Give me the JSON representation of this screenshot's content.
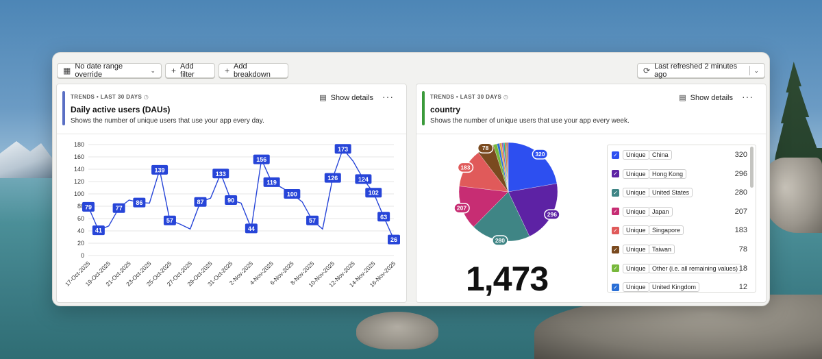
{
  "toolbar": {
    "date_label": "No date range override",
    "filter_label": "Add filter",
    "breakdown_label": "Add breakdown",
    "refresh_label": "Last refreshed 2 minutes ago"
  },
  "cards": [
    {
      "kicker": "TRENDS • LAST 30 DAYS",
      "title": "Daily active users (DAUs)",
      "description": "Shows the number of unique users that use your app every day.",
      "details_label": "Show details",
      "accent": "#5a6fc4"
    },
    {
      "kicker": "TRENDS • LAST 30 DAYS",
      "title": "country",
      "description": "Shows the number of unique users that use your app every week.",
      "details_label": "Show details",
      "accent": "#3a9a3a"
    }
  ],
  "chart_data": [
    {
      "type": "line",
      "x": [
        "17-Oct-2025",
        "18-Oct-2025",
        "19-Oct-2025",
        "20-Oct-2025",
        "21-Oct-2025",
        "22-Oct-2025",
        "23-Oct-2025",
        "24-Oct-2025",
        "25-Oct-2025",
        "26-Oct-2025",
        "27-Oct-2025",
        "28-Oct-2025",
        "29-Oct-2025",
        "30-Oct-2025",
        "31-Oct-2025",
        "1-Nov-2025",
        "2-Nov-2025",
        "3-Nov-2025",
        "4-Nov-2025",
        "5-Nov-2025",
        "6-Nov-2025",
        "7-Nov-2025",
        "8-Nov-2025",
        "9-Nov-2025",
        "10-Nov-2025",
        "11-Nov-2025",
        "12-Nov-2025",
        "13-Nov-2025",
        "14-Nov-2025",
        "15-Nov-2025",
        "16-Nov-2025"
      ],
      "tick_labels": [
        "17-Oct-2025",
        "19-Oct-2025",
        "21-Oct-2025",
        "23-Oct-2025",
        "25-Oct-2025",
        "27-Oct-2025",
        "29-Oct-2025",
        "31-Oct-2025",
        "2-Nov-2025",
        "4-Nov-2025",
        "6-Nov-2025",
        "8-Nov-2025",
        "10-Nov-2025",
        "12-Nov-2025",
        "14-Nov-2025",
        "16-Nov-2025"
      ],
      "series": [
        {
          "values": [
            79,
            41,
            48,
            77,
            90,
            86,
            85,
            139,
            57,
            51,
            43,
            87,
            93,
            133,
            90,
            85,
            44,
            156,
            119,
            110,
            100,
            87,
            57,
            43,
            126,
            173,
            153,
            124,
            102,
            63,
            26
          ],
          "labeled": [
            0,
            1,
            3,
            5,
            7,
            8,
            11,
            13,
            14,
            16,
            17,
            18,
            20,
            22,
            24,
            25,
            27,
            28,
            29,
            30
          ],
          "color": "#2745d8"
        }
      ],
      "ylim": [
        0,
        180
      ],
      "yticks": [
        0,
        20,
        40,
        60,
        80,
        100,
        120,
        140,
        160,
        180
      ],
      "grid": true
    },
    {
      "type": "pie",
      "total_label": "1,473",
      "slices": [
        {
          "label": "China",
          "value": 320,
          "color": "#2d4ff0",
          "show": true
        },
        {
          "label": "Hong Kong",
          "value": 296,
          "color": "#5d22a4",
          "show": true
        },
        {
          "label": "United States",
          "value": 280,
          "color": "#3f8585",
          "show": true
        },
        {
          "label": "Japan",
          "value": 207,
          "color": "#c72d73",
          "show": true
        },
        {
          "label": "Singapore",
          "value": 183,
          "color": "#e05a5a",
          "show": true
        },
        {
          "label": "Taiwan",
          "value": 78,
          "color": "#7a4a1f",
          "show": true
        },
        {
          "label": "Other (i.e. all remaining values)",
          "value": 18,
          "color": "#78b83c",
          "show": false
        },
        {
          "label": "United Kingdom",
          "value": 12,
          "color": "#2a6fd6",
          "show": false
        },
        {
          "label": "",
          "value": 10,
          "color": "#e6a23c",
          "show": false
        },
        {
          "label": "",
          "value": 8,
          "color": "#9b59b6",
          "show": false
        },
        {
          "label": "",
          "value": 7,
          "color": "#1abc9c",
          "show": false
        },
        {
          "label": "",
          "value": 6,
          "color": "#d35400",
          "show": false
        },
        {
          "label": "",
          "value": 5,
          "color": "#7f8c8d",
          "show": false
        },
        {
          "label": "",
          "value": 5,
          "color": "#c0392b",
          "show": false
        }
      ]
    }
  ],
  "legend": {
    "unique_label": "Unique",
    "rows": [
      {
        "name": "China",
        "value": "320",
        "color": "#2d4ff0"
      },
      {
        "name": "Hong Kong",
        "value": "296",
        "color": "#5d22a4"
      },
      {
        "name": "United States",
        "value": "280",
        "color": "#3f8585"
      },
      {
        "name": "Japan",
        "value": "207",
        "color": "#c72d73"
      },
      {
        "name": "Singapore",
        "value": "183",
        "color": "#e05a5a"
      },
      {
        "name": "Taiwan",
        "value": "78",
        "color": "#7a4a1f"
      },
      {
        "name": "Other (i.e. all remaining values)",
        "value": "18",
        "color": "#78b83c"
      },
      {
        "name": "United Kingdom",
        "value": "12",
        "color": "#2a6fd6"
      }
    ]
  }
}
